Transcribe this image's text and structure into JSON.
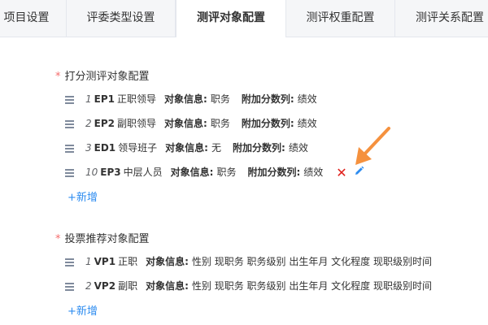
{
  "tabs": [
    {
      "label": "项目设置"
    },
    {
      "label": "评委类型设置"
    },
    {
      "label": "测评对象配置"
    },
    {
      "label": "测评权重配置"
    },
    {
      "label": "测评关系配置"
    }
  ],
  "scoring_section": {
    "required_mark": "*",
    "title": "打分测评对象配置",
    "rows": [
      {
        "index": "1",
        "code": "EP1",
        "name": "正职领导",
        "info_label": "对象信息:",
        "info_value": "职务",
        "extra_label": "附加分数列:",
        "extra_value": "绩效"
      },
      {
        "index": "2",
        "code": "EP2",
        "name": "副职领导",
        "info_label": "对象信息:",
        "info_value": "职务",
        "extra_label": "附加分数列:",
        "extra_value": "绩效"
      },
      {
        "index": "3",
        "code": "ED1",
        "name": "领导班子",
        "info_label": "对象信息:",
        "info_value": "无",
        "extra_label": "附加分数列:",
        "extra_value": "绩效"
      },
      {
        "index": "10",
        "code": "EP3",
        "name": "中层人员",
        "info_label": "对象信息:",
        "info_value": "职务",
        "extra_label": "附加分数列:",
        "extra_value": "绩效"
      }
    ],
    "add_label": "+新增"
  },
  "voting_section": {
    "required_mark": "*",
    "title": "投票推荐对象配置",
    "rows": [
      {
        "index": "1",
        "code": "VP1",
        "name": "正职",
        "info_label": "对象信息:",
        "info_value": "性别 现职务 职务级别 出生年月 文化程度 现职级别时间"
      },
      {
        "index": "2",
        "code": "VP2",
        "name": "副职",
        "info_label": "对象信息:",
        "info_value": "性别 现职务 职务级别 出生年月 文化程度 现职级别时间"
      }
    ],
    "add_label": "+新增"
  },
  "icons": {
    "delete": "close-icon",
    "edit": "pencil-icon",
    "handle": "drag-handle-icon",
    "annotation": "arrow-icon"
  },
  "colors": {
    "accent": "#2d8cf0",
    "delete": "#e0201b",
    "required": "#f56c6c",
    "annotation_arrow": "#f5913e"
  }
}
